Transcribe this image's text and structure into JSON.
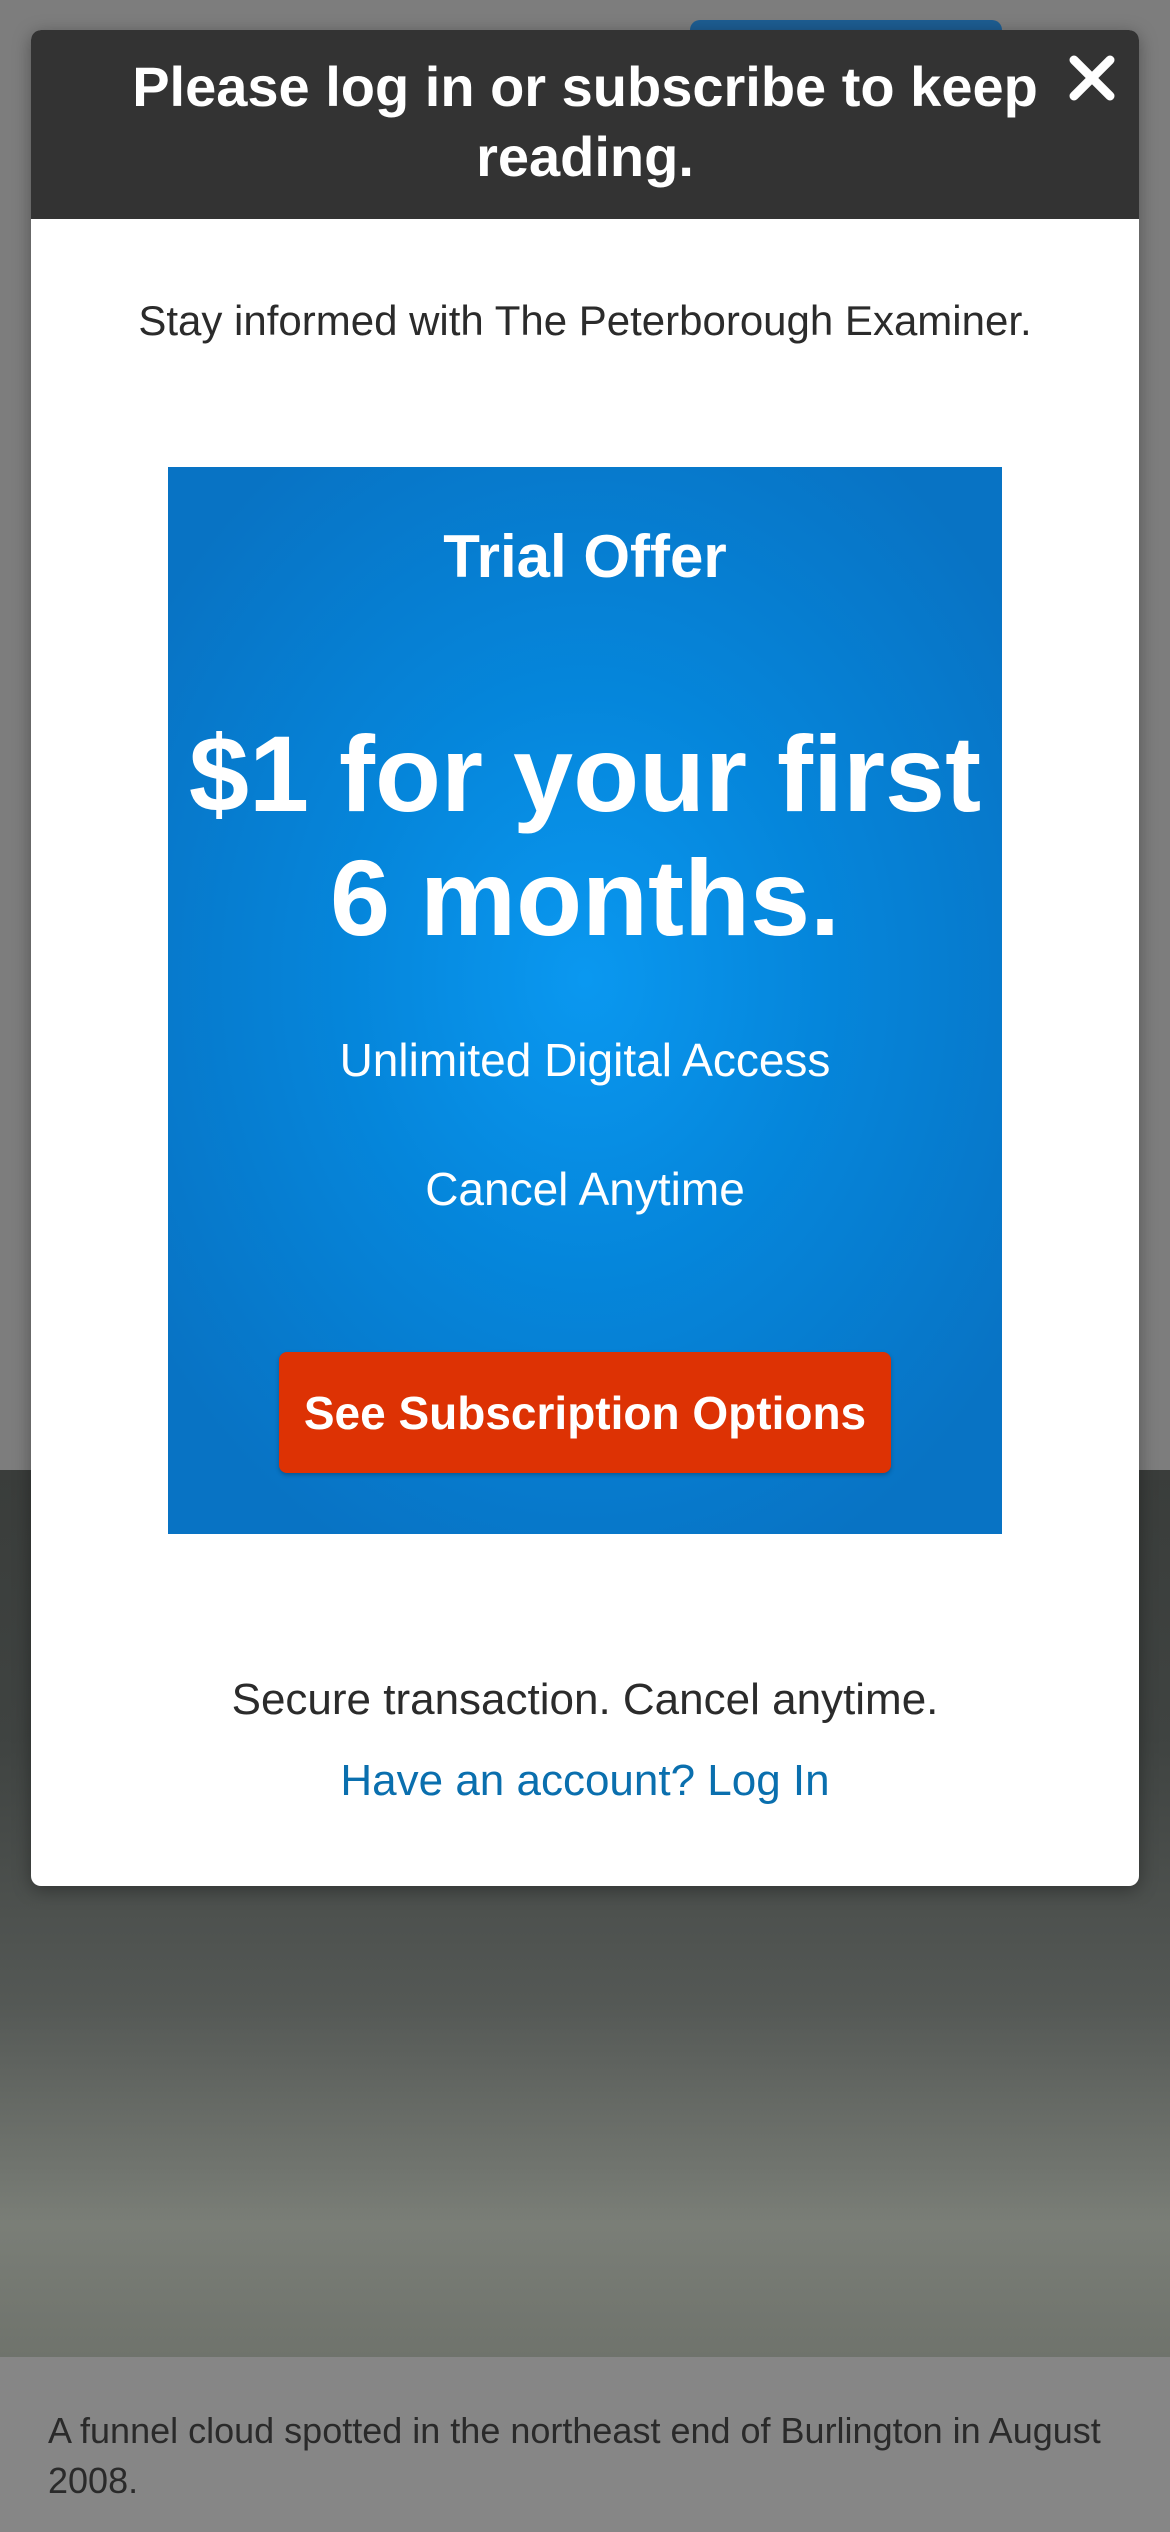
{
  "modal": {
    "title": "Please log in or subscribe to keep reading.",
    "close_icon": "close-icon",
    "tagline": "Stay informed with The Peterborough Examiner.",
    "offer": {
      "label": "Trial Offer",
      "price": "$1 for your first 6 months.",
      "features": [
        "Unlimited Digital Access",
        "Cancel Anytime"
      ],
      "cta_label": "See Subscription Options"
    },
    "secure_text": "Secure transaction. Cancel anytime.",
    "login_link": "Have an account? Log In"
  },
  "article": {
    "photo_caption": "A funnel cloud spotted in the northeast end of Burlington in August 2008."
  },
  "colors": {
    "header_bg": "#333333",
    "offer_blue": "#0586db",
    "cta_red": "#dd3204",
    "link_blue": "#0a6fae"
  }
}
